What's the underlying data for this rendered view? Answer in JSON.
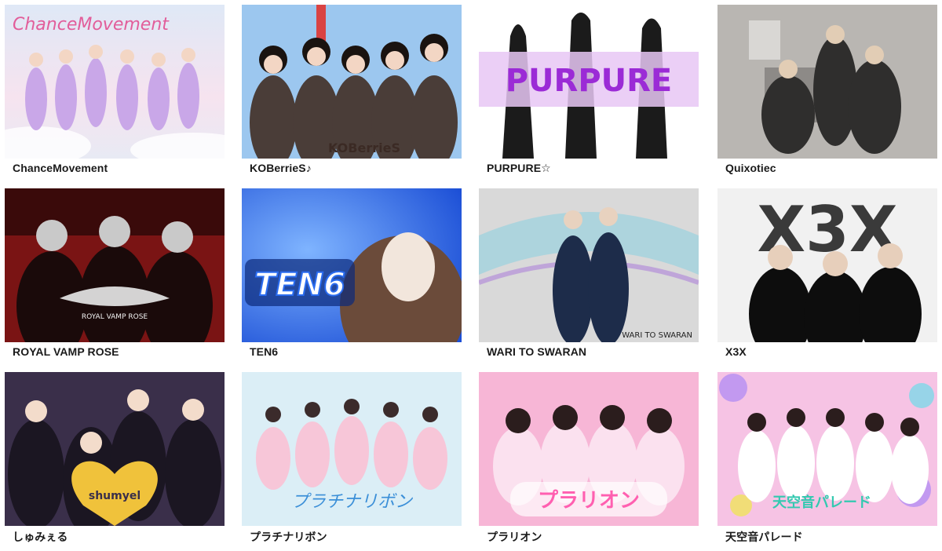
{
  "groups": [
    {
      "name": "ChanceMovement",
      "logo": "ChanceMovement",
      "theme_colors": [
        "#dfe8f6",
        "#f6e3ef",
        "#c9a7e8"
      ],
      "logo_color": "#e25d9a"
    },
    {
      "name": "KOBerrieS♪",
      "logo": "KOBerrieS",
      "theme_colors": [
        "#9cc7ef",
        "#4a3d38",
        "#d94343"
      ],
      "logo_color": "#3b2a24"
    },
    {
      "name": "PURPURE☆",
      "logo": "PURPURE",
      "theme_colors": [
        "#ffffff",
        "#b23adf",
        "#1b1b1b"
      ],
      "logo_color": "#9b2bd6"
    },
    {
      "name": "Quixotiec",
      "logo": "",
      "theme_colors": [
        "#b9b6b2",
        "#6e6b69",
        "#2f2e2d"
      ],
      "logo_color": "#444444"
    },
    {
      "name": "ROYAL VAMP ROSE",
      "logo": "ROYAL VAMP ROSE",
      "theme_colors": [
        "#7a1414",
        "#1a0a0a",
        "#c9c9c9"
      ],
      "logo_color": "#f2f2f2"
    },
    {
      "name": "TEN6",
      "logo": "TEN6",
      "theme_colors": [
        "#1c4fd6",
        "#7fb4ff",
        "#f2e6dc"
      ],
      "logo_color": "#2a6cf0"
    },
    {
      "name": "WARI TO SWARAN",
      "logo": "WARI TO SWARAN",
      "theme_colors": [
        "#d9d9d9",
        "#8fd0e0",
        "#1d2c4a"
      ],
      "logo_color": "#222222"
    },
    {
      "name": "X3X",
      "logo": "X3X",
      "theme_colors": [
        "#f1f1f1",
        "#3a3a3a",
        "#0d0d0d"
      ],
      "logo_color": "#3a3a3a"
    },
    {
      "name": "しゅみぇる",
      "logo": "shumyel",
      "theme_colors": [
        "#3a2f4a",
        "#f0c23b",
        "#6fd2a9"
      ],
      "logo_color": "#f4d13e"
    },
    {
      "name": "プラチナリボン",
      "logo": "プラチナリボン",
      "theme_colors": [
        "#dbeef6",
        "#f7c6d8",
        "#8a8fd9"
      ],
      "logo_color": "#3b8fd8"
    },
    {
      "name": "プラリオン",
      "logo": "プラリオン",
      "theme_colors": [
        "#f7b6d6",
        "#f07fb6",
        "#fbe1ef"
      ],
      "logo_color": "#ff5fb0"
    },
    {
      "name": "天空音パレード",
      "logo": "天空音パレード",
      "theme_colors": [
        "#f6c3e4",
        "#b58ef2",
        "#7fd8e8"
      ],
      "logo_color": "#33c9b0"
    }
  ]
}
